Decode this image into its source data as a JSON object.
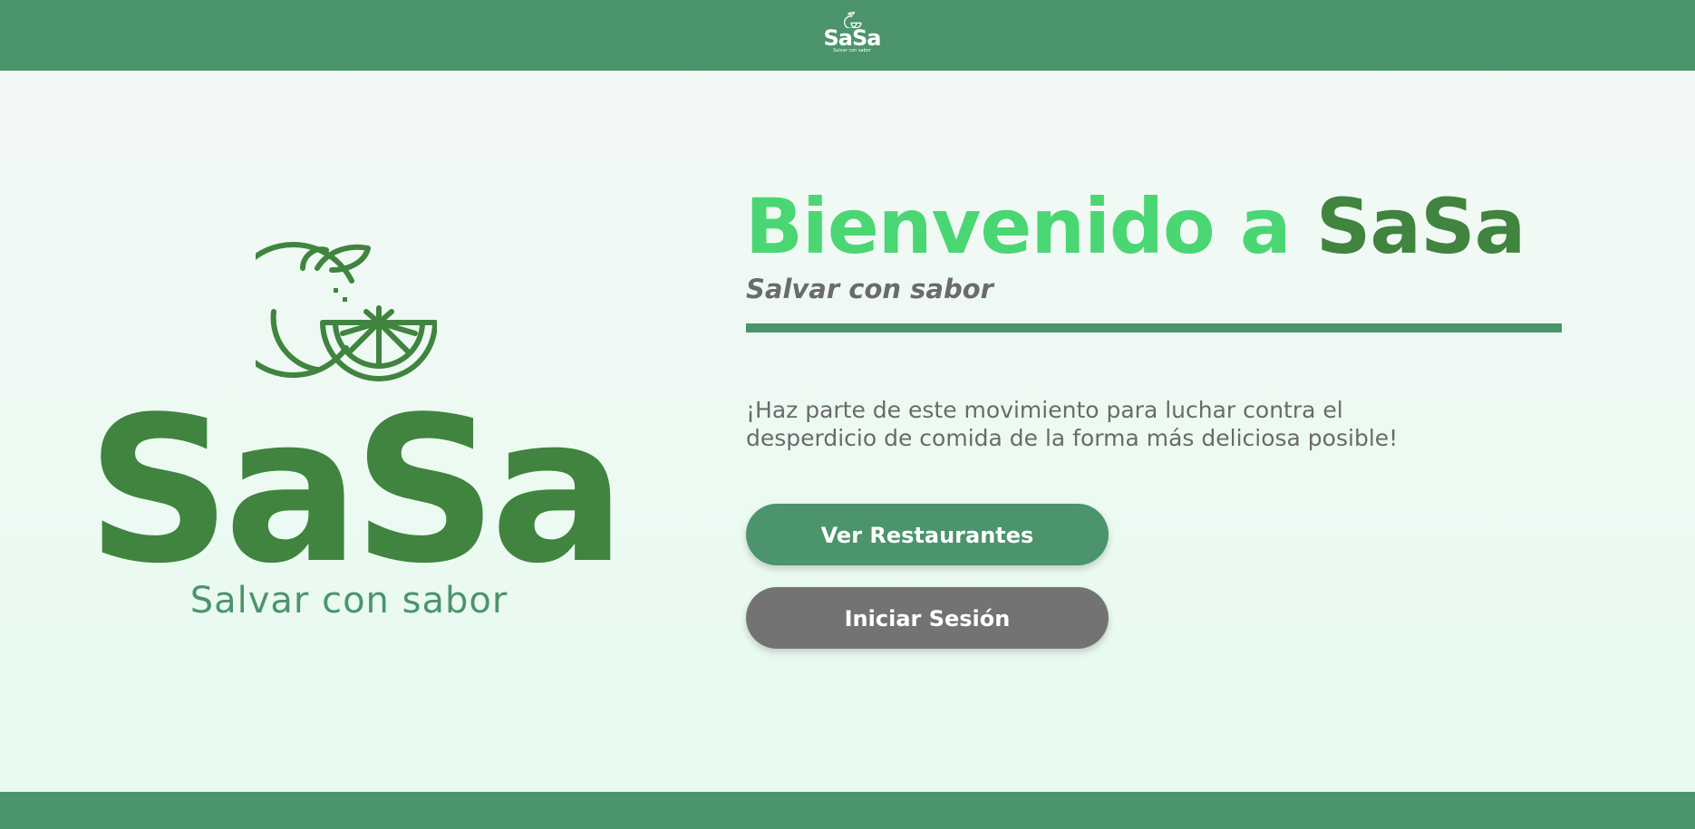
{
  "header": {
    "logo_word": "SaSa",
    "logo_tagline": "Salvar con sabor"
  },
  "brand": {
    "logo_icon": "orange-fruit-icon",
    "wordmark": "SaSa",
    "tagline": "Salvar con sabor"
  },
  "hero": {
    "title_part1": "Bienvenido a ",
    "title_part2": "SaSa",
    "subtitle": "Salvar con sabor",
    "description": "¡Haz parte de este movimiento para luchar contra el desperdicio de comida de la forma más deliciosa posible!",
    "primary_button": "Ver Restaurantes",
    "secondary_button": "Iniciar Sesión"
  },
  "colors": {
    "bar_green": "#4b946c",
    "brand_dark_green": "#40843f",
    "bright_green": "#4bd674",
    "gray_text": "#6b6b6b",
    "gray_button": "#737373"
  }
}
